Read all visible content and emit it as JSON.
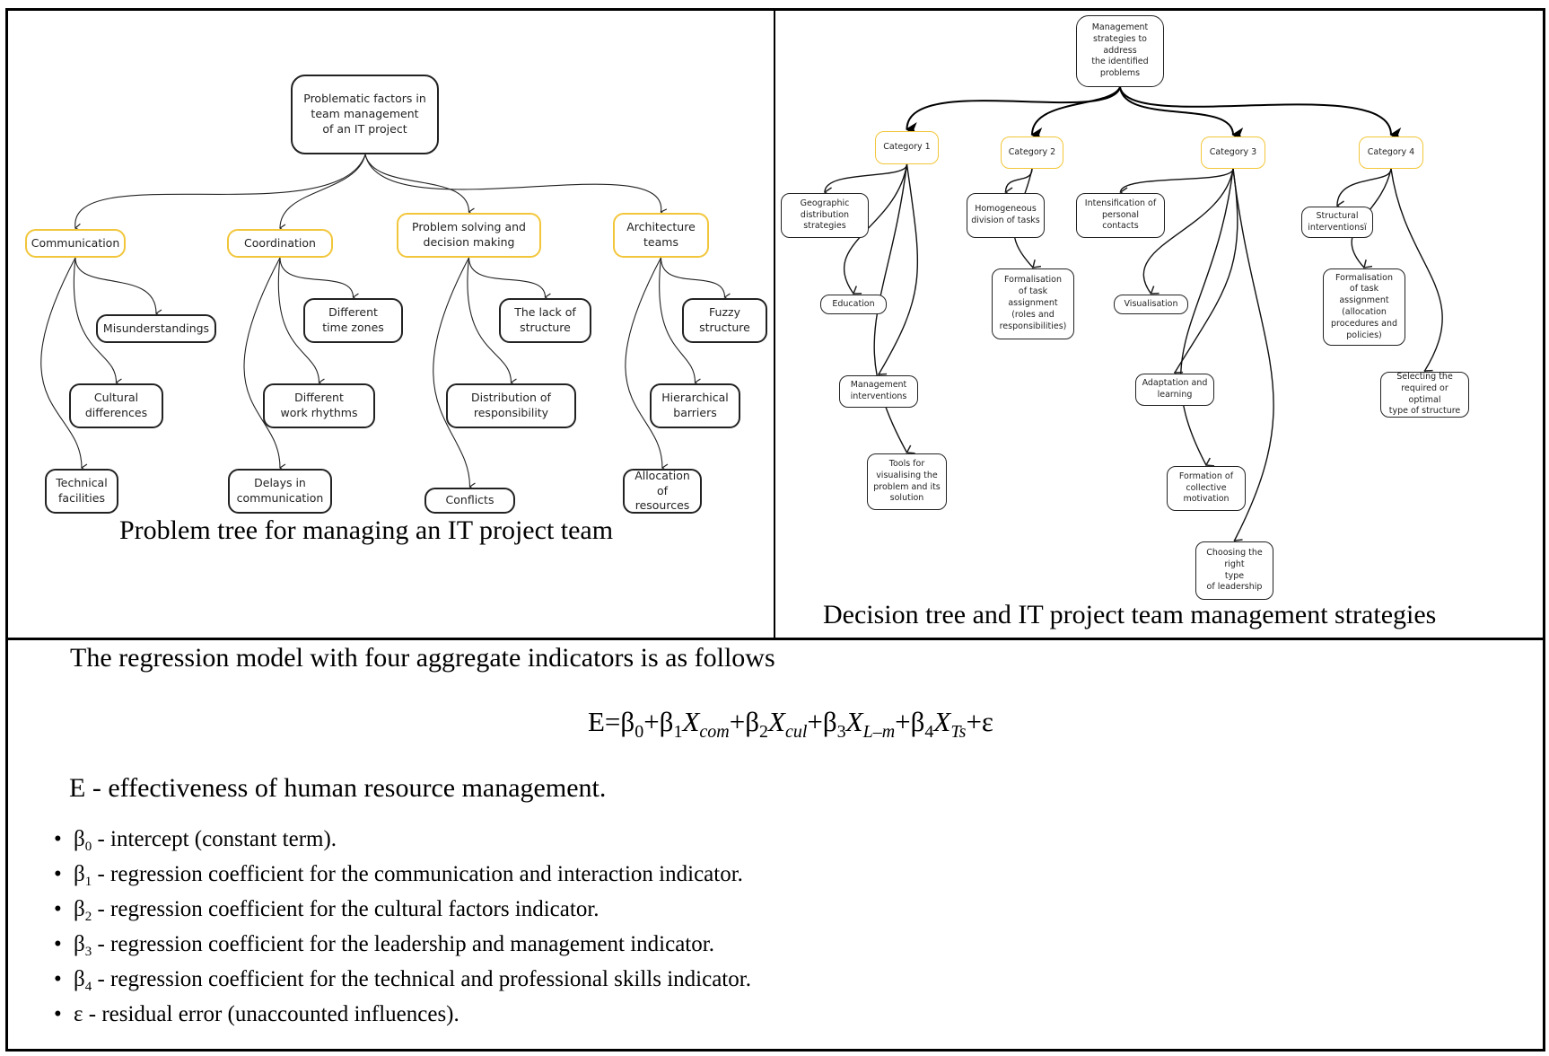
{
  "problem_tree": {
    "caption": "Problem tree for managing an IT project team",
    "root": "Problematic factors in team management of an IT project",
    "root_lines": [
      "Problematic factors in",
      "team management",
      "of an IT project"
    ],
    "categories": [
      {
        "label_lines": [
          "Communication"
        ],
        "children": [
          {
            "label_lines": [
              "Misunderstandings"
            ]
          },
          {
            "label_lines": [
              "Cultural",
              "differences"
            ]
          },
          {
            "label_lines": [
              "Technical",
              "facilities"
            ]
          }
        ]
      },
      {
        "label_lines": [
          "Coordination"
        ],
        "children": [
          {
            "label_lines": [
              "Different",
              "time zones"
            ]
          },
          {
            "label_lines": [
              "Different",
              "work rhythms"
            ]
          },
          {
            "label_lines": [
              "Delays in",
              "communication"
            ]
          }
        ]
      },
      {
        "label_lines": [
          "Problem solving and",
          "decision making"
        ],
        "children": [
          {
            "label_lines": [
              "The lack of",
              "structure"
            ]
          },
          {
            "label_lines": [
              "Distribution of",
              "responsibility"
            ]
          },
          {
            "label_lines": [
              "Conflicts"
            ]
          }
        ]
      },
      {
        "label_lines": [
          "Architecture",
          "teams"
        ],
        "children": [
          {
            "label_lines": [
              "Fuzzy",
              "structure"
            ]
          },
          {
            "label_lines": [
              "Hierarchical",
              "barriers"
            ]
          },
          {
            "label_lines": [
              "Allocation of",
              "resources"
            ]
          }
        ]
      }
    ]
  },
  "decision_tree": {
    "caption": "Decision tree and IT project team management strategies",
    "root_lines": [
      "Management",
      "strategies to address",
      "the identified",
      "problems"
    ],
    "categories": [
      {
        "label_lines": [
          "Category 1"
        ],
        "children": [
          {
            "label_lines": [
              "Geographic",
              "distribution",
              "strategies"
            ]
          },
          {
            "label_lines": [
              "Education"
            ]
          },
          {
            "label_lines": [
              "Management",
              "interventions"
            ]
          },
          {
            "label_lines": [
              "Tools for",
              "visualising the",
              "problem and its",
              "solution"
            ]
          }
        ]
      },
      {
        "label_lines": [
          "Category 2"
        ],
        "children": [
          {
            "label_lines": [
              "Homogeneous",
              "division of tasks"
            ]
          },
          {
            "label_lines": [
              "Formalisation",
              "of task assignment",
              "(roles and",
              "responsibilities)"
            ]
          }
        ]
      },
      {
        "label_lines": [
          "Category 3"
        ],
        "children": [
          {
            "label_lines": [
              "Intensification of",
              "personal",
              "contacts"
            ]
          },
          {
            "label_lines": [
              "Visualisation"
            ]
          },
          {
            "label_lines": [
              "Adaptation and",
              "learning"
            ]
          },
          {
            "label_lines": [
              "Formation of",
              "collective",
              "motivation"
            ]
          },
          {
            "label_lines": [
              "Choosing the right",
              "type",
              "of leadership"
            ]
          }
        ]
      },
      {
        "label_lines": [
          "Category 4"
        ],
        "children": [
          {
            "label_lines": [
              "Structural",
              "interventionsї"
            ]
          },
          {
            "label_lines": [
              "Formalisation",
              "of task assignment",
              "(allocation",
              "procedures and",
              "policies)"
            ]
          },
          {
            "label_lines": [
              "Selecting the",
              "required or optimal",
              "type of structure"
            ]
          }
        ]
      }
    ]
  },
  "regression": {
    "intro": "The regression model with four aggregate indicators is as follows",
    "formula_parts": [
      {
        "t": "E=β",
        "s": "0"
      },
      {
        "t": "+β",
        "s": "1"
      },
      {
        "i": "X",
        "si": "com"
      },
      {
        "t": "+β",
        "s": "2"
      },
      {
        "i": "X",
        "si": "cul"
      },
      {
        "t": "+β",
        "s": "3"
      },
      {
        "i": "X",
        "si": "L–m"
      },
      {
        "t": "+β",
        "s": "4"
      },
      {
        "i": "X",
        "si": "Ts"
      },
      {
        "t": "+ε"
      }
    ],
    "dependent_definition": "E - effectiveness of human resource management.",
    "definitions": [
      {
        "symbol": "β",
        "sub": "0",
        "text": " - intercept (constant term)."
      },
      {
        "symbol": "β",
        "sub": "1",
        "text": " - regression coefficient for the communication and interaction indicator."
      },
      {
        "symbol": "β",
        "sub": "2",
        "text": " - regression coefficient for the cultural factors indicator."
      },
      {
        "symbol": "β",
        "sub": "3",
        "text": " - regression coefficient for the leadership and management indicator."
      },
      {
        "symbol": "β",
        "sub": "4",
        "text": " - regression coefficient for the technical and professional skills indicator."
      },
      {
        "symbol": "ε",
        "sub": "",
        "text": " - residual error (unaccounted influences)."
      }
    ],
    "bullet": "•"
  },
  "colors": {
    "category_border": "#f2c63a",
    "node_border": "#222222",
    "frame": "#000000"
  }
}
